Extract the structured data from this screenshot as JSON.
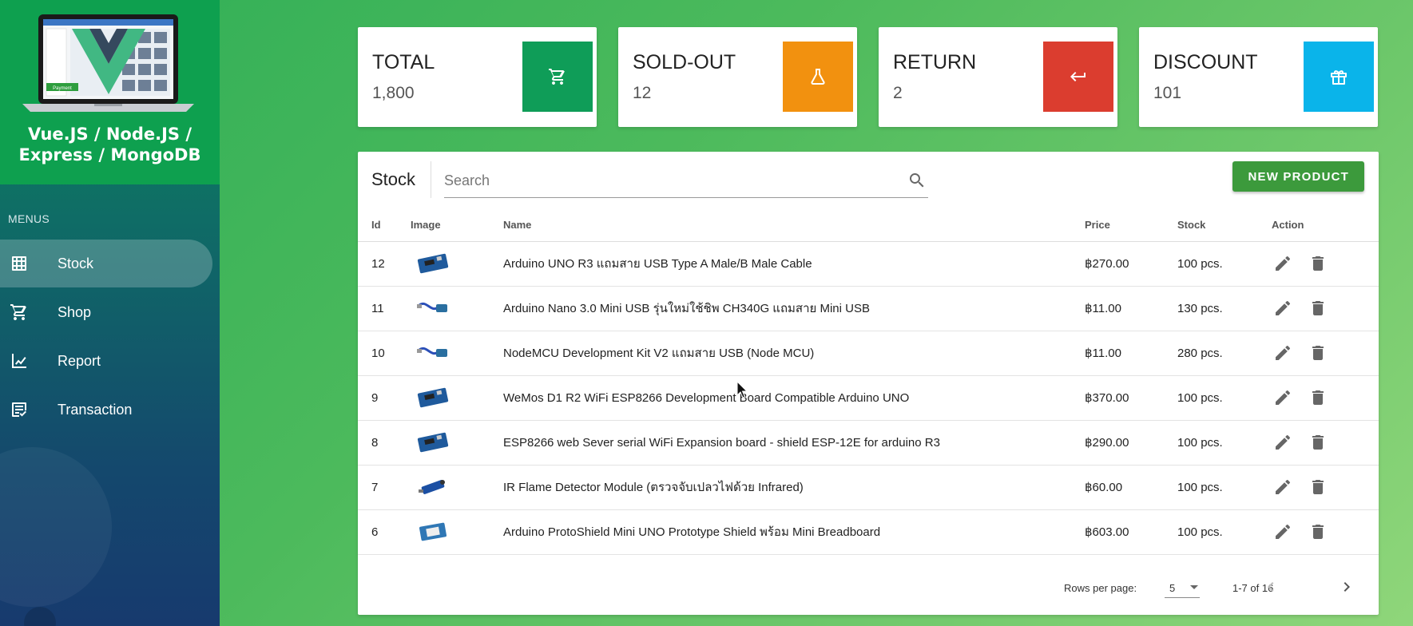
{
  "sidebar": {
    "brand_line1": "Vue.JS / Node.JS /",
    "brand_line2": "Express / MongoDB",
    "laptop_screen_button": "Payment",
    "menus_label": "MENUS",
    "items": [
      {
        "label": "Stock",
        "icon": "grid-icon",
        "active": true
      },
      {
        "label": "Shop",
        "icon": "cart-icon",
        "active": false
      },
      {
        "label": "Report",
        "icon": "chart-icon",
        "active": false
      },
      {
        "label": "Transaction",
        "icon": "receipt-icon",
        "active": false
      }
    ]
  },
  "stats": [
    {
      "title": "TOTAL",
      "value": "1,800",
      "color": "#0f9d58",
      "icon": "cart-icon"
    },
    {
      "title": "SOLD-OUT",
      "value": "12",
      "color": "#f2910f",
      "icon": "flask-icon"
    },
    {
      "title": "RETURN",
      "value": "2",
      "color": "#db3d2f",
      "icon": "return-arrow-icon"
    },
    {
      "title": "DISCOUNT",
      "value": "101",
      "color": "#0ab4ea",
      "icon": "gift-icon"
    }
  ],
  "stock": {
    "title": "Stock",
    "search_placeholder": "Search",
    "search_value": "",
    "new_button": "NEW PRODUCT",
    "columns": [
      "Id",
      "Image",
      "Name",
      "Price",
      "Stock",
      "Action"
    ],
    "rows": [
      {
        "id": "12",
        "name": "Arduino UNO R3 แถมสาย USB Type A Male/B Male Cable",
        "price": "฿270.00",
        "stock": "100 pcs.",
        "thumb": "board"
      },
      {
        "id": "11",
        "name": "Arduino Nano 3.0 Mini USB รุ่นใหม่ใช้ชิพ CH340G แถมสาย Mini USB",
        "price": "฿11.00",
        "stock": "130 pcs.",
        "thumb": "cable"
      },
      {
        "id": "10",
        "name": "NodeMCU Development Kit V2 แถมสาย USB (Node MCU)",
        "price": "฿11.00",
        "stock": "280 pcs.",
        "thumb": "cable"
      },
      {
        "id": "9",
        "name": "WeMos D1 R2 WiFi ESP8266 Development Board Compatible Arduino UNO",
        "price": "฿370.00",
        "stock": "100 pcs.",
        "thumb": "board"
      },
      {
        "id": "8",
        "name": "ESP8266 web Sever serial WiFi Expansion board - shield ESP-12E for arduino R3",
        "price": "฿290.00",
        "stock": "100 pcs.",
        "thumb": "board"
      },
      {
        "id": "7",
        "name": "IR Flame Detector Module (ตรวจจับเปลวไฟด้วย Infrared)",
        "price": "฿60.00",
        "stock": "100 pcs.",
        "thumb": "sensor"
      },
      {
        "id": "6",
        "name": "Arduino ProtoShield Mini UNO Prototype Shield พร้อม Mini Breadboard",
        "price": "฿603.00",
        "stock": "100 pcs.",
        "thumb": "proto"
      }
    ],
    "rows_per_page_label": "Rows per page:",
    "rows_per_page_value": "5",
    "page_info": "1-7 of 16"
  }
}
